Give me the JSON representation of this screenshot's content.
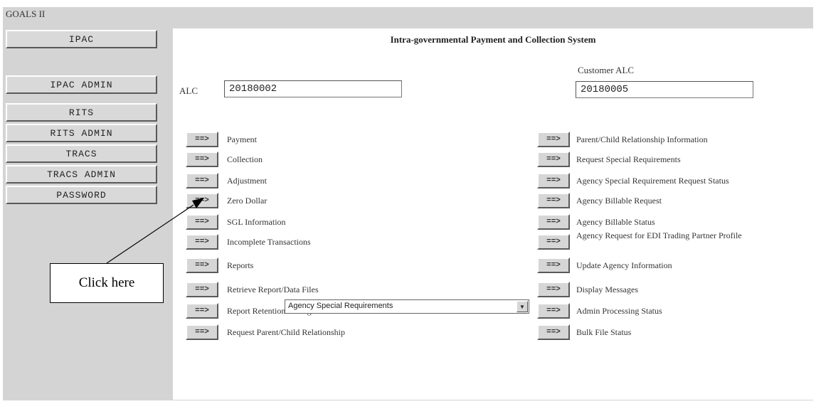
{
  "app": {
    "title": "GOALS II"
  },
  "sidebar": {
    "items": [
      {
        "label": "IPAC"
      },
      {
        "label": "IPAC ADMIN"
      },
      {
        "label": "RITS"
      },
      {
        "label": "RITS ADMIN"
      },
      {
        "label": "TRACS"
      },
      {
        "label": "TRACS ADMIN"
      },
      {
        "label": "PASSWORD"
      }
    ]
  },
  "main": {
    "title": "Intra-governmental Payment and Collection System",
    "alc": {
      "label": "ALC",
      "value": "20180002"
    },
    "customer_alc": {
      "label": "Customer ALC",
      "value": "20180005"
    },
    "arrow_label": "==>",
    "left_items": [
      "Payment",
      "Collection",
      "Adjustment",
      "Zero Dollar",
      "SGL Information",
      "Incomplete Transactions",
      "Reports",
      "Retrieve Report/Data Files",
      "Report Retention Management",
      "Request Parent/Child Relationship"
    ],
    "reports_select": {
      "selected": "Agency Special Requirements"
    },
    "right_items": [
      "Parent/Child Relationship Information",
      "Request Special Requirements",
      "Agency Special Requirement Request Status",
      "Agency Billable Request",
      "Agency Billable Status",
      "Agency Request for EDI Trading Partner Profile",
      "Update Agency Information",
      "Display Messages",
      "Admin Processing Status",
      "Bulk File Status"
    ]
  },
  "callout": {
    "text": "Click here"
  }
}
